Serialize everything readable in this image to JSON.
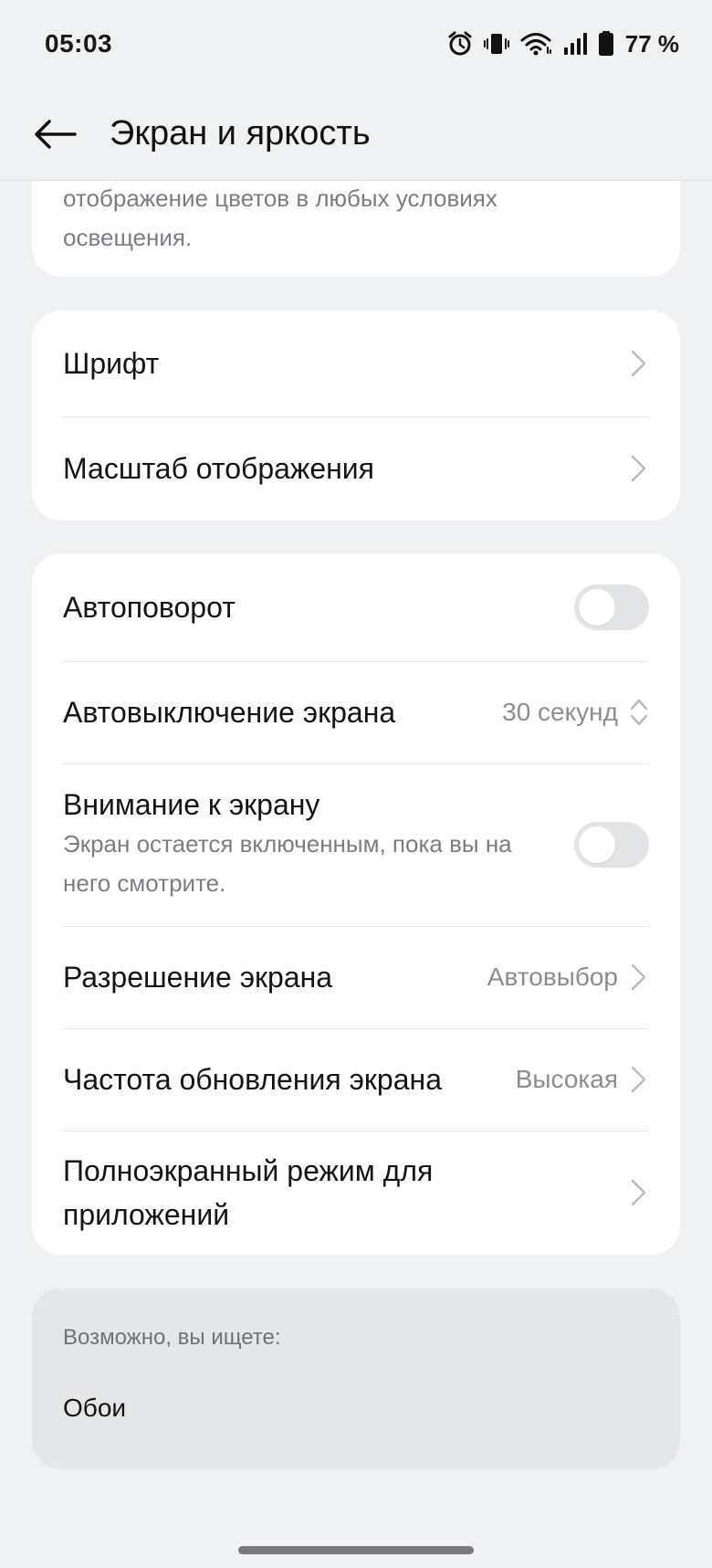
{
  "status": {
    "time": "05:03",
    "battery": "77 %",
    "icons": [
      "alarm-icon",
      "vibrate-icon",
      "wifi-icon",
      "signal-icon",
      "battery-icon"
    ]
  },
  "header": {
    "title": "Экран и яркость",
    "back_icon": "arrow-left-icon"
  },
  "top_card": {
    "description": "отображение цветов в любых условиях освещения."
  },
  "group1": {
    "font": "Шрифт",
    "display_scale": "Масштаб отображения"
  },
  "group2": {
    "autorotate": {
      "label": "Автоповорот",
      "enabled": false
    },
    "screen_timeout": {
      "label": "Автовыключение экрана",
      "value": "30 секунд"
    },
    "screen_attention": {
      "label": "Внимание к экрану",
      "description": "Экран остается включенным, пока вы на него смотрите.",
      "enabled": false
    },
    "resolution": {
      "label": "Разрешение экрана",
      "value": "Автовыбор"
    },
    "refresh_rate": {
      "label": "Частота обновления экрана",
      "value": "Высокая"
    },
    "fullscreen_apps": {
      "label": "Полноэкранный режим для приложений"
    }
  },
  "suggestions": {
    "label": "Возможно, вы ищете:",
    "items": [
      "Обои"
    ]
  },
  "colors": {
    "background": "#f0f1f3",
    "card": "#ffffff",
    "toggle_off": "#e3e4e6",
    "secondary_text": "#7a7d82"
  }
}
